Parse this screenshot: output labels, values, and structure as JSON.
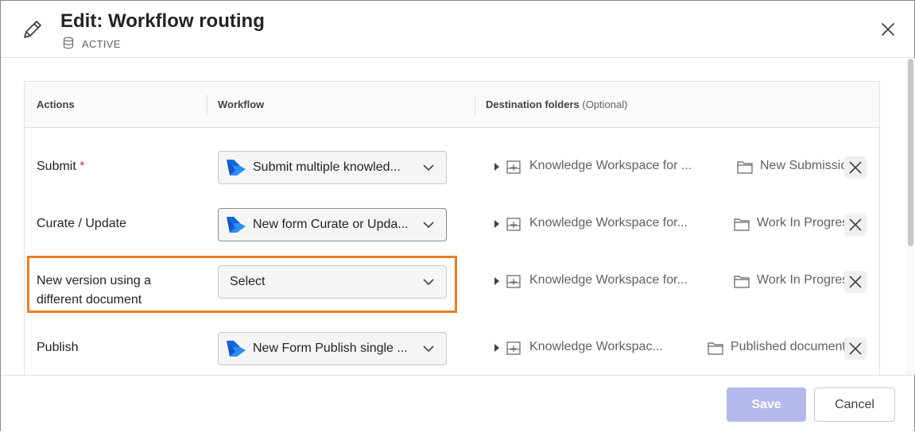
{
  "header": {
    "title": "Edit: Workflow routing",
    "status": "ACTIVE",
    "icons": {
      "edit": "pencil-icon",
      "status": "database-icon",
      "close": "close-icon"
    }
  },
  "table": {
    "columns": {
      "actions": "Actions",
      "workflow": "Workflow",
      "destination": "Destination folders",
      "destination_optional": "(Optional)"
    },
    "rows": [
      {
        "action": "Submit",
        "required": "*",
        "workflow": "Submit multiple knowled...",
        "workspace": "Knowledge Workspace for ...",
        "folder": "New Submission"
      },
      {
        "action": "Curate / Update",
        "workflow": "New form Curate or Upda...",
        "workspace": "Knowledge Workspace for...",
        "folder": "Work In Progress"
      },
      {
        "action_line1": "New version using a",
        "action_line2": "different document",
        "workflow": "Select",
        "workspace": "Knowledge Workspace for...",
        "folder": "Work In Progress"
      },
      {
        "action": "Publish",
        "workflow": "New Form Publish single ...",
        "workspace": "Knowledge Workspac...",
        "folder": "Published documents"
      }
    ]
  },
  "footer": {
    "save_label": "Save",
    "cancel_label": "Cancel"
  },
  "colors": {
    "highlight": "#f07c21",
    "save_disabled": "#b4b8ec",
    "required": "#c4314b"
  }
}
